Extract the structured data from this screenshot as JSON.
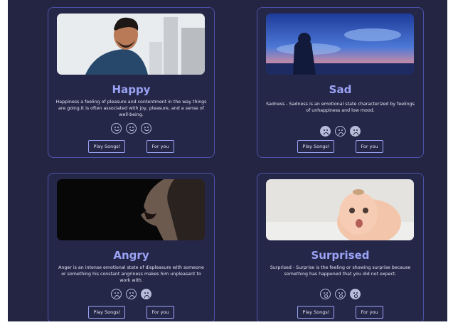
{
  "cards": [
    {
      "title": "Happy",
      "description": "Happiness a feeling of pleasure and contentment in the way things are going.It is often associated with joy, pleasure, and a sense of well-being.",
      "play_label": "Play Songs!",
      "foryou_label": "For you",
      "emojis": [
        "smile-icon",
        "smile-icon",
        "smile-icon"
      ]
    },
    {
      "title": "Sad",
      "description": "Sadness - Sadness is an emotional state characterized by feelings of unhappiness and low mood.",
      "play_label": "Play Songs!",
      "foryou_label": "For you",
      "emojis": [
        "frown-icon",
        "frown-icon",
        "crying-icon"
      ]
    },
    {
      "title": "Angry",
      "description": "Anger is an intense emotional state of displeasure with someone or something his constant angriness makes him unpleasant to work with.",
      "play_label": "Play Songs!",
      "foryou_label": "For you",
      "emojis": [
        "frown-icon",
        "frown-icon",
        "angry-icon"
      ]
    },
    {
      "title": "Surprised",
      "description": "Surprised - Surprise is the feeling or showing surprise because something has happened that you did not expect.",
      "play_label": "Play Songs!",
      "foryou_label": "For you",
      "emojis": [
        "surprised-icon",
        "surprised-icon",
        "surprised-icon"
      ]
    }
  ],
  "colors": {
    "background": "#242543",
    "card_border": "#4d52a8",
    "title": "#9ba3f5",
    "text": "#e6e6f2"
  }
}
